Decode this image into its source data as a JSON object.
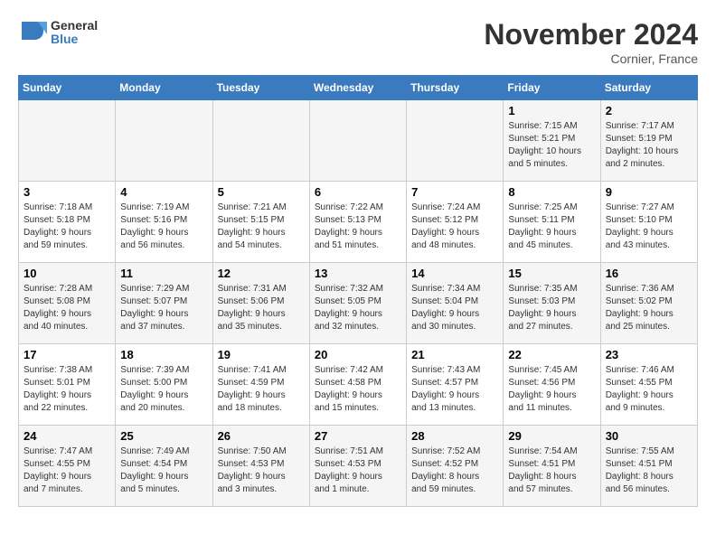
{
  "header": {
    "logo_line1": "General",
    "logo_line2": "Blue",
    "month": "November 2024",
    "location": "Cornier, France"
  },
  "days_of_week": [
    "Sunday",
    "Monday",
    "Tuesday",
    "Wednesday",
    "Thursday",
    "Friday",
    "Saturday"
  ],
  "weeks": [
    [
      {
        "day": "",
        "info": ""
      },
      {
        "day": "",
        "info": ""
      },
      {
        "day": "",
        "info": ""
      },
      {
        "day": "",
        "info": ""
      },
      {
        "day": "",
        "info": ""
      },
      {
        "day": "1",
        "info": "Sunrise: 7:15 AM\nSunset: 5:21 PM\nDaylight: 10 hours\nand 5 minutes."
      },
      {
        "day": "2",
        "info": "Sunrise: 7:17 AM\nSunset: 5:19 PM\nDaylight: 10 hours\nand 2 minutes."
      }
    ],
    [
      {
        "day": "3",
        "info": "Sunrise: 7:18 AM\nSunset: 5:18 PM\nDaylight: 9 hours\nand 59 minutes."
      },
      {
        "day": "4",
        "info": "Sunrise: 7:19 AM\nSunset: 5:16 PM\nDaylight: 9 hours\nand 56 minutes."
      },
      {
        "day": "5",
        "info": "Sunrise: 7:21 AM\nSunset: 5:15 PM\nDaylight: 9 hours\nand 54 minutes."
      },
      {
        "day": "6",
        "info": "Sunrise: 7:22 AM\nSunset: 5:13 PM\nDaylight: 9 hours\nand 51 minutes."
      },
      {
        "day": "7",
        "info": "Sunrise: 7:24 AM\nSunset: 5:12 PM\nDaylight: 9 hours\nand 48 minutes."
      },
      {
        "day": "8",
        "info": "Sunrise: 7:25 AM\nSunset: 5:11 PM\nDaylight: 9 hours\nand 45 minutes."
      },
      {
        "day": "9",
        "info": "Sunrise: 7:27 AM\nSunset: 5:10 PM\nDaylight: 9 hours\nand 43 minutes."
      }
    ],
    [
      {
        "day": "10",
        "info": "Sunrise: 7:28 AM\nSunset: 5:08 PM\nDaylight: 9 hours\nand 40 minutes."
      },
      {
        "day": "11",
        "info": "Sunrise: 7:29 AM\nSunset: 5:07 PM\nDaylight: 9 hours\nand 37 minutes."
      },
      {
        "day": "12",
        "info": "Sunrise: 7:31 AM\nSunset: 5:06 PM\nDaylight: 9 hours\nand 35 minutes."
      },
      {
        "day": "13",
        "info": "Sunrise: 7:32 AM\nSunset: 5:05 PM\nDaylight: 9 hours\nand 32 minutes."
      },
      {
        "day": "14",
        "info": "Sunrise: 7:34 AM\nSunset: 5:04 PM\nDaylight: 9 hours\nand 30 minutes."
      },
      {
        "day": "15",
        "info": "Sunrise: 7:35 AM\nSunset: 5:03 PM\nDaylight: 9 hours\nand 27 minutes."
      },
      {
        "day": "16",
        "info": "Sunrise: 7:36 AM\nSunset: 5:02 PM\nDaylight: 9 hours\nand 25 minutes."
      }
    ],
    [
      {
        "day": "17",
        "info": "Sunrise: 7:38 AM\nSunset: 5:01 PM\nDaylight: 9 hours\nand 22 minutes."
      },
      {
        "day": "18",
        "info": "Sunrise: 7:39 AM\nSunset: 5:00 PM\nDaylight: 9 hours\nand 20 minutes."
      },
      {
        "day": "19",
        "info": "Sunrise: 7:41 AM\nSunset: 4:59 PM\nDaylight: 9 hours\nand 18 minutes."
      },
      {
        "day": "20",
        "info": "Sunrise: 7:42 AM\nSunset: 4:58 PM\nDaylight: 9 hours\nand 15 minutes."
      },
      {
        "day": "21",
        "info": "Sunrise: 7:43 AM\nSunset: 4:57 PM\nDaylight: 9 hours\nand 13 minutes."
      },
      {
        "day": "22",
        "info": "Sunrise: 7:45 AM\nSunset: 4:56 PM\nDaylight: 9 hours\nand 11 minutes."
      },
      {
        "day": "23",
        "info": "Sunrise: 7:46 AM\nSunset: 4:55 PM\nDaylight: 9 hours\nand 9 minutes."
      }
    ],
    [
      {
        "day": "24",
        "info": "Sunrise: 7:47 AM\nSunset: 4:55 PM\nDaylight: 9 hours\nand 7 minutes."
      },
      {
        "day": "25",
        "info": "Sunrise: 7:49 AM\nSunset: 4:54 PM\nDaylight: 9 hours\nand 5 minutes."
      },
      {
        "day": "26",
        "info": "Sunrise: 7:50 AM\nSunset: 4:53 PM\nDaylight: 9 hours\nand 3 minutes."
      },
      {
        "day": "27",
        "info": "Sunrise: 7:51 AM\nSunset: 4:53 PM\nDaylight: 9 hours\nand 1 minute."
      },
      {
        "day": "28",
        "info": "Sunrise: 7:52 AM\nSunset: 4:52 PM\nDaylight: 8 hours\nand 59 minutes."
      },
      {
        "day": "29",
        "info": "Sunrise: 7:54 AM\nSunset: 4:51 PM\nDaylight: 8 hours\nand 57 minutes."
      },
      {
        "day": "30",
        "info": "Sunrise: 7:55 AM\nSunset: 4:51 PM\nDaylight: 8 hours\nand 56 minutes."
      }
    ]
  ]
}
